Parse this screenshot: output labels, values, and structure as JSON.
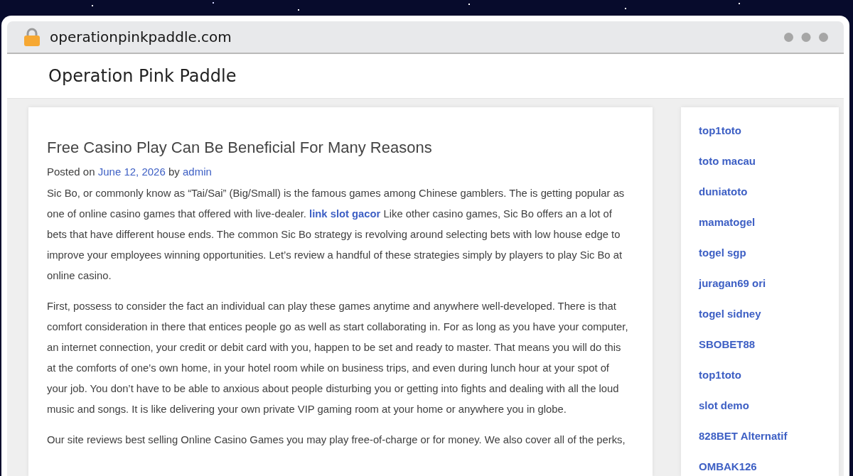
{
  "browser": {
    "url": "operationpinkpaddle.com"
  },
  "site": {
    "title": "Operation Pink Paddle"
  },
  "post": {
    "title": "Free Casino Play Can Be Beneficial For Many Reasons",
    "meta": [
      {
        "kind": "text",
        "text": "Posted on "
      },
      {
        "kind": "link",
        "text": "June 12, 2026"
      },
      {
        "kind": "text",
        "text": " by "
      },
      {
        "kind": "link",
        "text": "admin"
      }
    ],
    "paragraphs": [
      [
        {
          "kind": "text",
          "text": "Sic Bo, or commonly know as “Tai/Sai” (Big/Small) is the famous games among Chinese gamblers. The is getting popular as one of online casino games that offered with live-dealer. "
        },
        {
          "kind": "link",
          "text": "link slot gacor"
        },
        {
          "kind": "text",
          "text": " Like other casino games, Sic Bo offers an a lot of bets that have different house ends. The common Sic Bo strategy is revolving around selecting bets with low house edge to improve your employees winning opportunities. Let’s review a handful of these strategies simply by players to play Sic Bo at online casino."
        }
      ],
      [
        {
          "kind": "text",
          "text": "First, possess to consider the fact an individual can play these games anytime and anywhere well-developed. There is that comfort consideration in there that entices people go as well as start collaborating in. For as long as you have your computer, an internet connection, your credit or debit card with you, happen to be set and ready to master. That means you will do this at the comforts of one’s own home, in your hotel room while on business trips, and even during lunch hour at your spot of your job. You don’t have to be able to anxious about people disturbing you or getting into fights and dealing with all the loud music and songs. It is like delivering your own private VIP gaming room at your home or anywhere you in globe."
        }
      ],
      [
        {
          "kind": "text",
          "text": "Our site reviews best selling Online Casino Games you may play free-of-charge or for money. We also cover all of the perks,"
        }
      ]
    ]
  },
  "sidebar": {
    "links": [
      "top1toto",
      "toto macau",
      "duniatoto",
      "mamatogel",
      "togel sgp",
      "juragan69 ori",
      "togel sidney",
      "SBOBET88",
      "top1toto",
      "slot demo",
      "828BET Alternatif",
      "OMBAK126"
    ]
  }
}
